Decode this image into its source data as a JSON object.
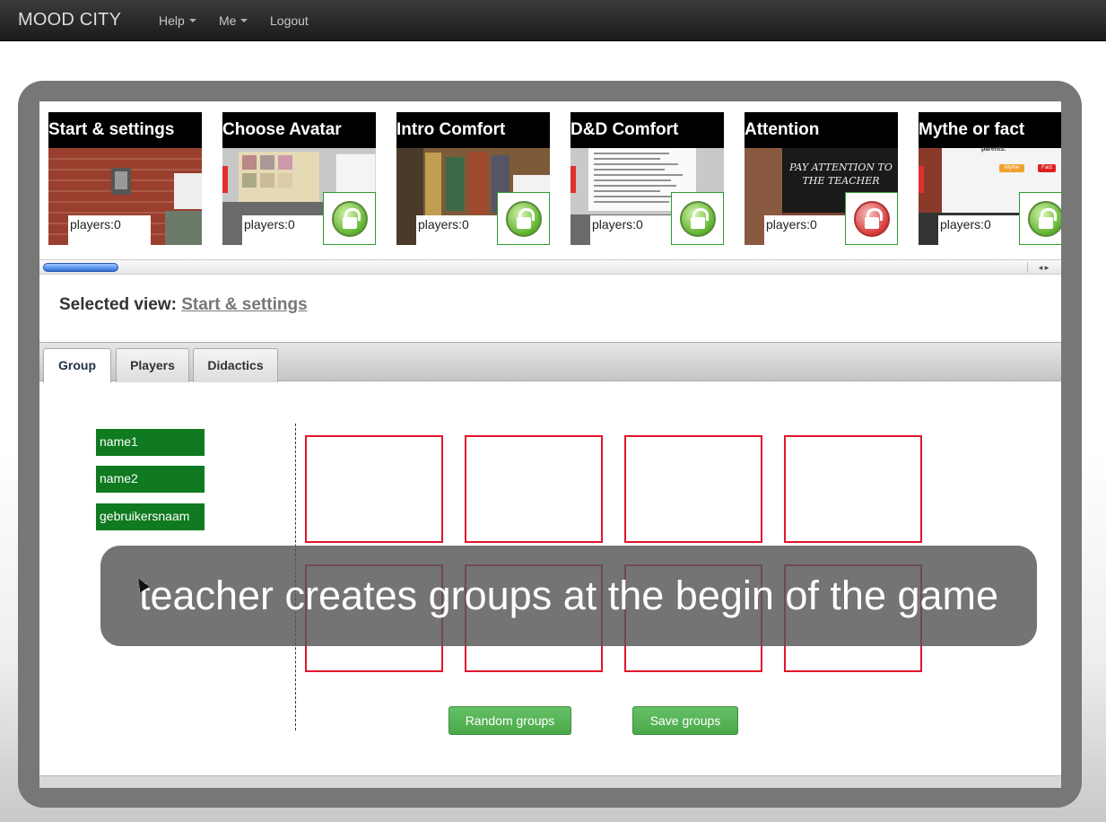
{
  "navbar": {
    "brand": "MOOD CITY",
    "help": "Help",
    "me": "Me",
    "logout": "Logout"
  },
  "scenes": [
    {
      "title": "Start & settings",
      "players": "players:0",
      "lock": null,
      "image": "brick wall with payphone"
    },
    {
      "title": "Choose Avatar",
      "players": "players:0",
      "lock": "unlocked",
      "image": "avatar board"
    },
    {
      "title": "Intro Comfort",
      "players": "players:0",
      "lock": "unlocked",
      "image": "graffiti street"
    },
    {
      "title": "D&D Comfort",
      "players": "players:0",
      "lock": "unlocked",
      "image": "statement sheet"
    },
    {
      "title": "Attention",
      "players": "players:0",
      "lock": "locked",
      "image": "PAY ATTENTION TO THE TEACHER chalkboard"
    },
    {
      "title": "Mythe or fact",
      "players": "players:0",
      "lock": "unlocked",
      "image": "board with myth / fact buttons"
    }
  ],
  "scene_images_text": {
    "attention_chalk": "PAY ATTENTION TO THE TEACHER",
    "mythe_small": "parents.",
    "mythe_btn1": "Mythe",
    "mythe_btn2": "Fact"
  },
  "selected_view": {
    "label": "Selected view:",
    "value": "Start & settings"
  },
  "tabs": [
    "Group",
    "Players",
    "Didactics"
  ],
  "active_tab": "Group",
  "names": [
    "name1",
    "name2",
    "gebruikersnaam"
  ],
  "buttons": {
    "random": "Random groups",
    "save": "Save groups"
  },
  "caption": "teacher creates groups at the begin of the game",
  "colors": {
    "chip_green": "#0f7a20",
    "group_border_red": "#e0162b",
    "button_green": "#5cb85c"
  }
}
